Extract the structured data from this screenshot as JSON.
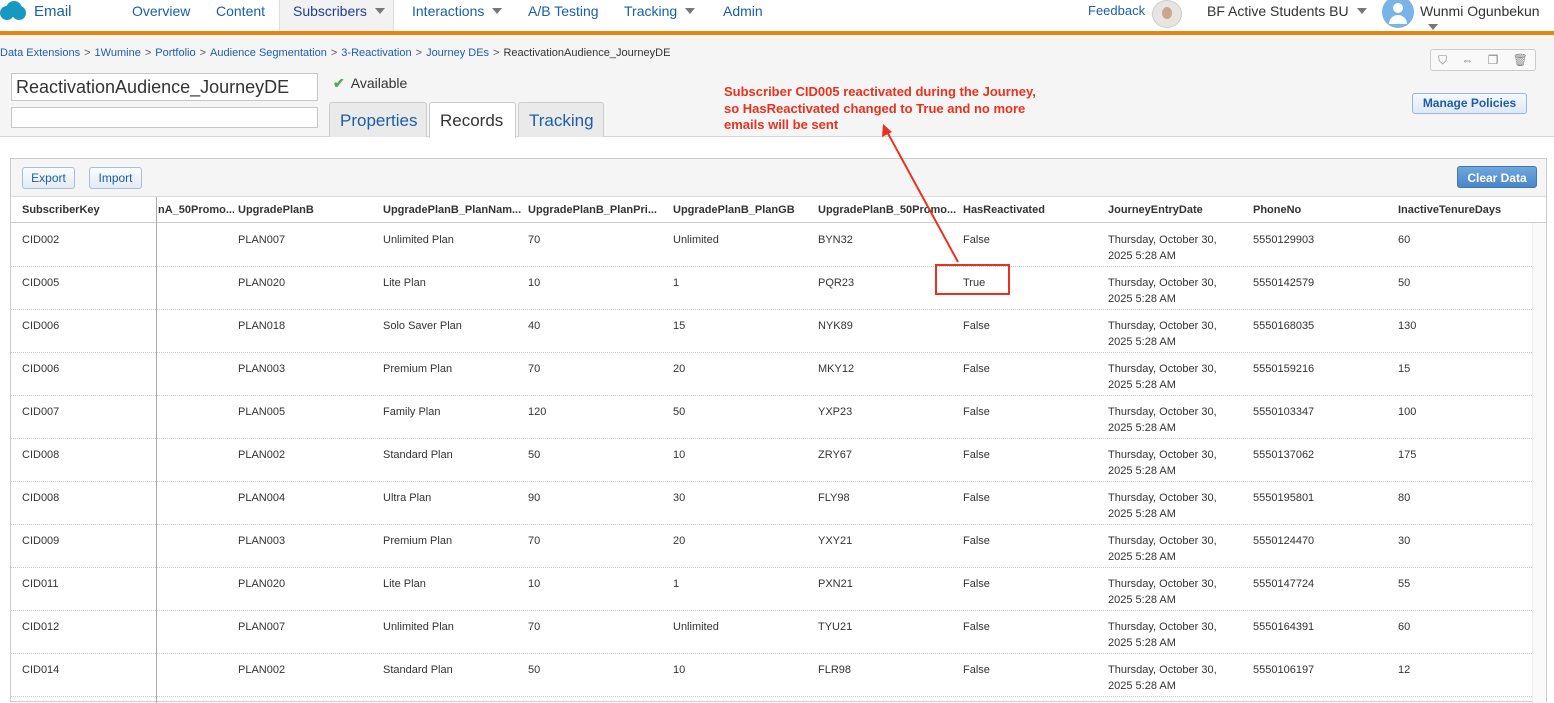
{
  "app": {
    "name": "Email"
  },
  "nav": {
    "items": [
      "Overview",
      "Content",
      "Subscribers",
      "Interactions",
      "A/B Testing",
      "Tracking",
      "Admin"
    ],
    "active": "Subscribers",
    "feedback": "Feedback",
    "business_unit": "BF Active Students BU",
    "user": "Wunmi Ogunbekun"
  },
  "breadcrumb": [
    "Data Extensions",
    "1Wumine",
    "Portfolio",
    "Audience Segmentation",
    "3-Reactivation",
    "Journey DEs",
    "ReactivationAudience_JourneyDE"
  ],
  "data_extension": {
    "name": "ReactivationAudience_JourneyDE",
    "description": "",
    "status": "Available"
  },
  "tabs": [
    "Properties",
    "Records",
    "Tracking"
  ],
  "active_tab": "Records",
  "buttons": {
    "manage_policies": "Manage Policies",
    "export": "Export",
    "import": "Import",
    "clear_data": "Clear Data"
  },
  "annotation": {
    "text": "Subscriber CID005 reactivated during the Journey, so HasReactivated changed to True and no more emails will be sent",
    "color": "#e8321f"
  },
  "table": {
    "columns": [
      "SubscriberKey",
      "nA_50Promo...",
      "UpgradePlanB",
      "UpgradePlanB_PlanNam...",
      "UpgradePlanB_PlanPri...",
      "UpgradePlanB_PlanGB",
      "UpgradePlanB_50Promo...",
      "HasReactivated",
      "JourneyEntryDate",
      "PhoneNo",
      "InactiveTenureDays"
    ],
    "rows": [
      [
        "CID002",
        "",
        "PLAN007",
        "Unlimited Plan",
        "70",
        "Unlimited",
        "BYN32",
        "False",
        "Thursday, October 30,",
        "2025 5:28 AM",
        "5550129903",
        "60"
      ],
      [
        "CID005",
        "",
        "PLAN020",
        "Lite Plan",
        "10",
        "1",
        "PQR23",
        "True",
        "Thursday, October 30,",
        "2025 5:28 AM",
        "5550142579",
        "50"
      ],
      [
        "CID006",
        "",
        "PLAN018",
        "Solo Saver Plan",
        "40",
        "15",
        "NYK89",
        "False",
        "Thursday, October 30,",
        "2025 5:28 AM",
        "5550168035",
        "130"
      ],
      [
        "CID006",
        "",
        "PLAN003",
        "Premium Plan",
        "70",
        "20",
        "MKY12",
        "False",
        "Thursday, October 30,",
        "2025 5:28 AM",
        "5550159216",
        "15"
      ],
      [
        "CID007",
        "",
        "PLAN005",
        "Family Plan",
        "120",
        "50",
        "YXP23",
        "False",
        "Thursday, October 30,",
        "2025 5:28 AM",
        "5550103347",
        "100"
      ],
      [
        "CID008",
        "",
        "PLAN002",
        "Standard Plan",
        "50",
        "10",
        "ZRY67",
        "False",
        "Thursday, October 30,",
        "2025 5:28 AM",
        "5550137062",
        "175"
      ],
      [
        "CID008",
        "",
        "PLAN004",
        "Ultra Plan",
        "90",
        "30",
        "FLY98",
        "False",
        "Thursday, October 30,",
        "2025 5:28 AM",
        "5550195801",
        "80"
      ],
      [
        "CID009",
        "",
        "PLAN003",
        "Premium Plan",
        "70",
        "20",
        "YXY21",
        "False",
        "Thursday, October 30,",
        "2025 5:28 AM",
        "5550124470",
        "30"
      ],
      [
        "CID011",
        "",
        "PLAN020",
        "Lite Plan",
        "10",
        "1",
        "PXN21",
        "False",
        "Thursday, October 30,",
        "2025 5:28 AM",
        "5550147724",
        "55"
      ],
      [
        "CID012",
        "",
        "PLAN007",
        "Unlimited Plan",
        "70",
        "Unlimited",
        "TYU21",
        "False",
        "Thursday, October 30,",
        "2025 5:28 AM",
        "5550164391",
        "60"
      ],
      [
        "CID014",
        "",
        "PLAN002",
        "Standard Plan",
        "50",
        "10",
        "FLR98",
        "False",
        "Thursday, October 30,",
        "2025 5:28 AM",
        "5550106197",
        "12"
      ]
    ]
  }
}
